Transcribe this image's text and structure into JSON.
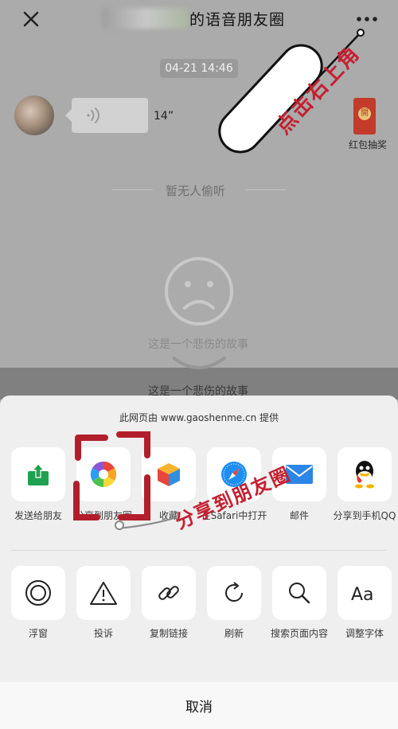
{
  "header": {
    "title": "的语音朋友圈",
    "close_icon": "close-icon",
    "more_icon": "more-dots-icon"
  },
  "chat": {
    "timestamp": "04-21 14:46",
    "voice_duration": "14”",
    "red_packet_seal": "開",
    "red_packet_label": "红包抽奖",
    "no_listener_text": "暂无人偷听",
    "sad_text": "这是一个悲伤的故事"
  },
  "share_sheet": {
    "provider_text": "此网页由 www.gaoshenme.cn 提供",
    "row1": [
      {
        "label": "发送给朋友",
        "icon": "send-to-friend-icon"
      },
      {
        "label": "分享到朋友圈",
        "icon": "moments-icon"
      },
      {
        "label": "收藏",
        "icon": "favorite-cube-icon"
      },
      {
        "label": "在Safari中打开",
        "icon": "safari-icon"
      },
      {
        "label": "邮件",
        "icon": "mail-icon"
      },
      {
        "label": "分享到手机QQ",
        "icon": "qq-icon"
      }
    ],
    "row2": [
      {
        "label": "浮窗",
        "icon": "float-window-icon"
      },
      {
        "label": "投诉",
        "icon": "warning-icon"
      },
      {
        "label": "复制链接",
        "icon": "link-icon"
      },
      {
        "label": "刷新",
        "icon": "refresh-icon"
      },
      {
        "label": "搜索页面内容",
        "icon": "search-icon"
      },
      {
        "label": "调整字体",
        "icon": "font-size-icon"
      }
    ],
    "cancel_label": "取消"
  },
  "annotations": {
    "top_callout": "点击右上角",
    "bottom_callout": "分享到朋友圈",
    "accent_color": "#c42031"
  }
}
